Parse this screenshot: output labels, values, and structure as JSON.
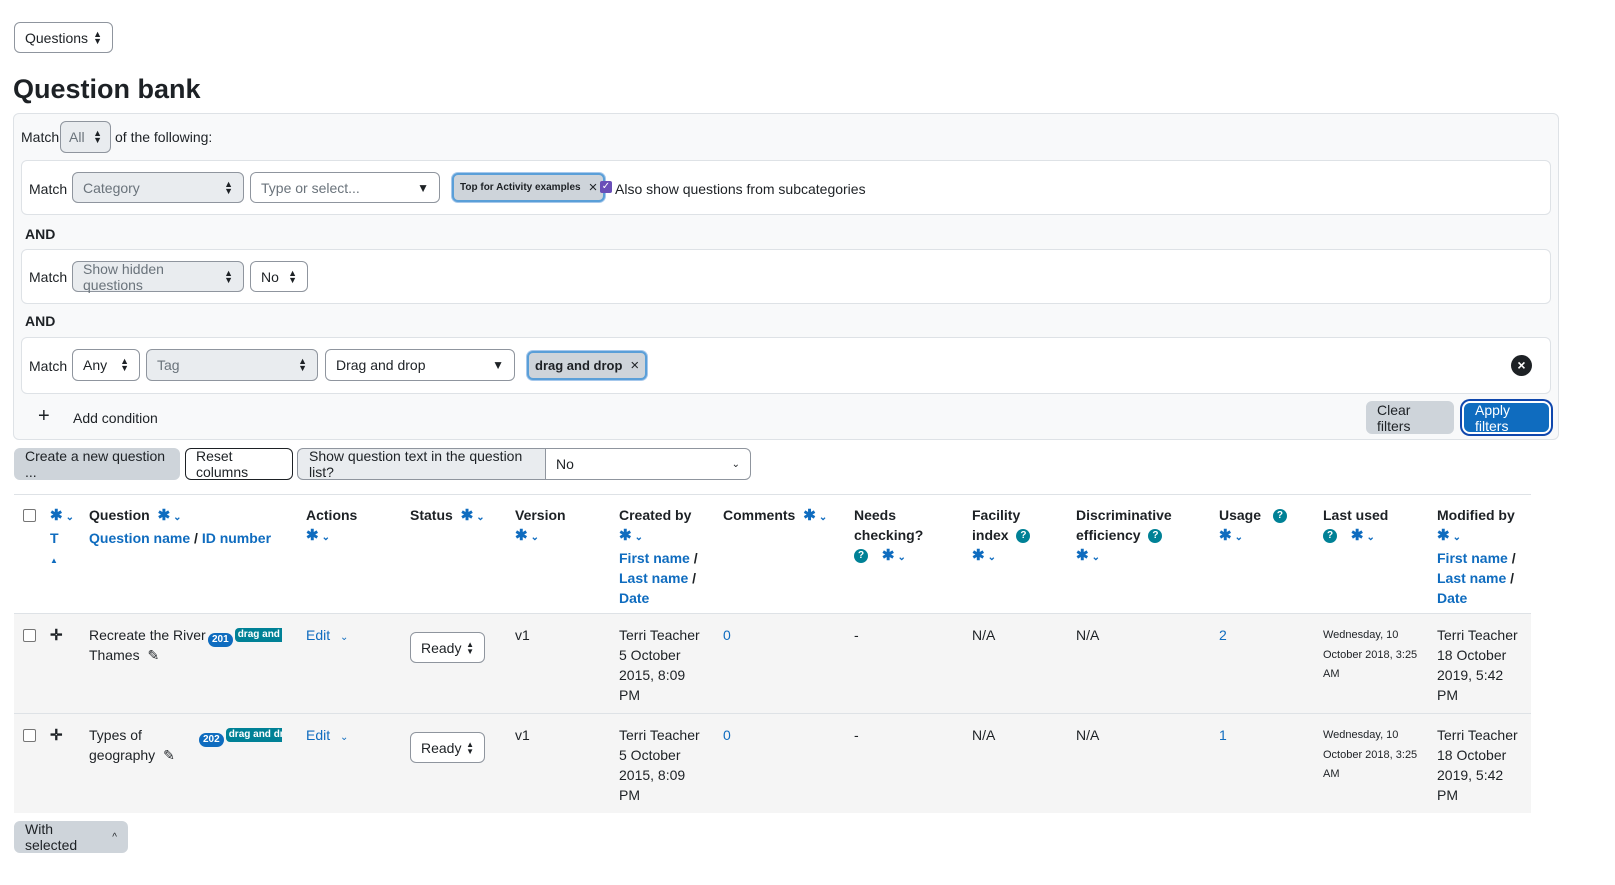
{
  "top_select": {
    "value": "Questions"
  },
  "page_title": "Question bank",
  "filters": {
    "match_label": "Match",
    "match_value": "All",
    "of_following": "of the following:",
    "and_label": "AND",
    "conditions": [
      {
        "match": "Match",
        "type": "Category",
        "input_placeholder": "Type or select...",
        "chip": "Top for Activity examples",
        "subcat_label": "Also show questions from subcategories"
      },
      {
        "match": "Match",
        "type": "Show hidden questions",
        "value": "No"
      },
      {
        "match": "Match",
        "join": "Any",
        "type": "Tag",
        "input_value": "Drag and drop",
        "chip": "drag and drop"
      }
    ],
    "add_condition": "Add condition",
    "clear_filters": "Clear filters",
    "apply_filters": "Apply filters"
  },
  "toolbar": {
    "create_new": "Create a new question ...",
    "reset_columns": "Reset columns",
    "show_text_label": "Show question text in the question list?",
    "show_text_value": "No"
  },
  "table": {
    "headers": {
      "type_sort": "T",
      "question": "Question",
      "question_name": "Question name",
      "id_number": "ID number",
      "actions": "Actions",
      "status": "Status",
      "version": "Version",
      "created_by": "Created by",
      "first_name": "First name",
      "last_name": "Last name",
      "date": "Date",
      "comments": "Comments",
      "needs_checking_1": "Needs",
      "needs_checking_2": "checking?",
      "facility_1": "Facility",
      "facility_2": "index",
      "discriminative_1": "Discriminative",
      "discriminative_2": "efficiency",
      "usage": "Usage",
      "last_used": "Last used",
      "modified_by": "Modified by"
    },
    "rows": [
      {
        "name_1": "Recreate the River",
        "name_2": "Thames",
        "badge": "201",
        "tag": "drag and drop",
        "action": "Edit",
        "status": "Ready",
        "version": "v1",
        "created_1": "Terri Teacher",
        "created_2": "5 October",
        "created_3": "2015, 8:09",
        "created_4": "PM",
        "comments": "0",
        "needs": "-",
        "facility": "N/A",
        "discrim": "N/A",
        "usage": "2",
        "last_1": "Wednesday, 10",
        "last_2": "October 2018, 3:25",
        "last_3": "AM",
        "mod_1": "Terri Teacher",
        "mod_2": "18 October",
        "mod_3": "2019, 5:42",
        "mod_4": "PM"
      },
      {
        "name_1": "Types of",
        "name_2": "geography",
        "badge": "202",
        "tag": "drag and drop",
        "action": "Edit",
        "status": "Ready",
        "version": "v1",
        "created_1": "Terri Teacher",
        "created_2": "5 October",
        "created_3": "2015, 8:09",
        "created_4": "PM",
        "comments": "0",
        "needs": "-",
        "facility": "N/A",
        "discrim": "N/A",
        "usage": "1",
        "last_1": "Wednesday, 10",
        "last_2": "October 2018, 3:25",
        "last_3": "AM",
        "mod_1": "Terri Teacher",
        "mod_2": "18 October",
        "mod_3": "2019, 5:42",
        "mod_4": "PM"
      }
    ]
  },
  "with_selected": "With selected"
}
